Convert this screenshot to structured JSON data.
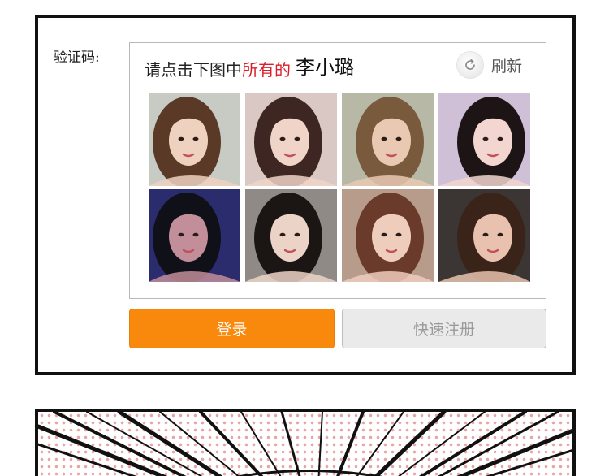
{
  "form": {
    "captcha_label": "验证码:",
    "prompt_prefix": "请点击下图中",
    "prompt_accent": "所有的",
    "prompt_target": "李小璐",
    "refresh_label": "刷新"
  },
  "buttons": {
    "login": "登录",
    "register": "快速注册"
  },
  "colors": {
    "accent_red": "#d91f2a",
    "login_orange": "#f8890d",
    "register_gray": "#eaeaea",
    "frame_black": "#111111"
  },
  "icons": {
    "refresh": "refresh-icon"
  },
  "photos": [
    {
      "id": "photo-1",
      "bg": "#c7cbc4",
      "hair": "#5a3a27",
      "skin": "#efd1c0"
    },
    {
      "id": "photo-2",
      "bg": "#d9c8c4",
      "hair": "#3e2622",
      "skin": "#f0d4c8"
    },
    {
      "id": "photo-3",
      "bg": "#b7b8a6",
      "hair": "#7a5a3c",
      "skin": "#e9c9b1"
    },
    {
      "id": "photo-4",
      "bg": "#cfc0d8",
      "hair": "#1d1416",
      "skin": "#f2d6cf"
    },
    {
      "id": "photo-5",
      "bg": "#2b2c6e",
      "hair": "#101018",
      "skin": "#c28e9a"
    },
    {
      "id": "photo-6",
      "bg": "#8f8a86",
      "hair": "#1b1614",
      "skin": "#ecd3c8"
    },
    {
      "id": "photo-7",
      "bg": "#b79c8c",
      "hair": "#6a3a2a",
      "skin": "#eecdbd"
    },
    {
      "id": "photo-8",
      "bg": "#3b3634",
      "hair": "#3a2318",
      "skin": "#e8c2ae"
    }
  ]
}
